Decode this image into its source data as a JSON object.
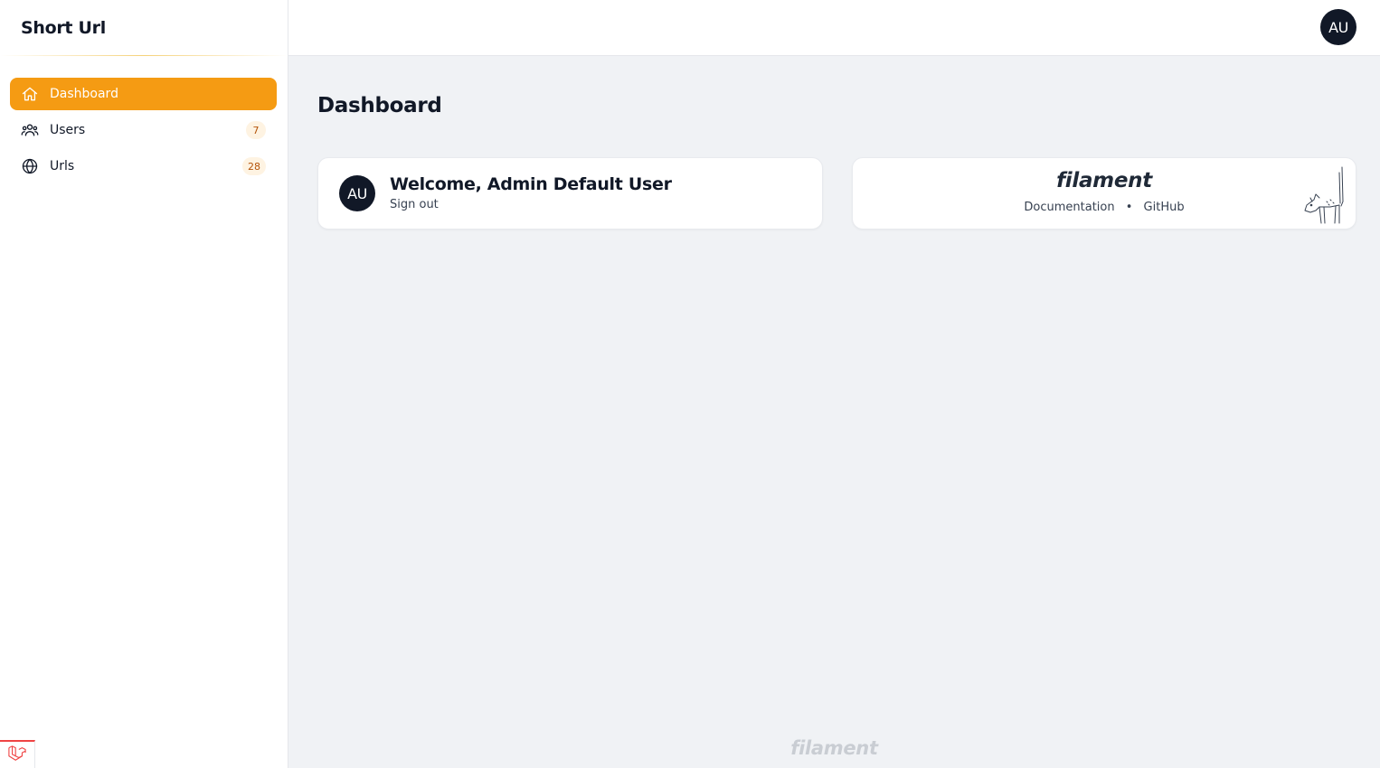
{
  "app": {
    "brand": "Short Url"
  },
  "user": {
    "initials": "AU"
  },
  "sidebar": {
    "items": [
      {
        "label": "Dashboard",
        "icon": "home-icon",
        "badge": "",
        "active": true
      },
      {
        "label": "Users",
        "icon": "users-icon",
        "badge": "7",
        "active": false
      },
      {
        "label": "Urls",
        "icon": "globe-icon",
        "badge": "28",
        "active": false
      }
    ]
  },
  "main": {
    "title": "Dashboard",
    "welcome": {
      "title": "Welcome, Admin Default User",
      "sign_out": "Sign out"
    },
    "filament": {
      "logo": "filament",
      "doc_link": "Documentation",
      "separator": "•",
      "github_link": "GitHub"
    },
    "footer_logo": "filament"
  },
  "colors": {
    "accent": "#f59b13",
    "badge_text": "#b45309",
    "avatar_bg": "#111827",
    "page_bg": "#f0f2f5"
  }
}
